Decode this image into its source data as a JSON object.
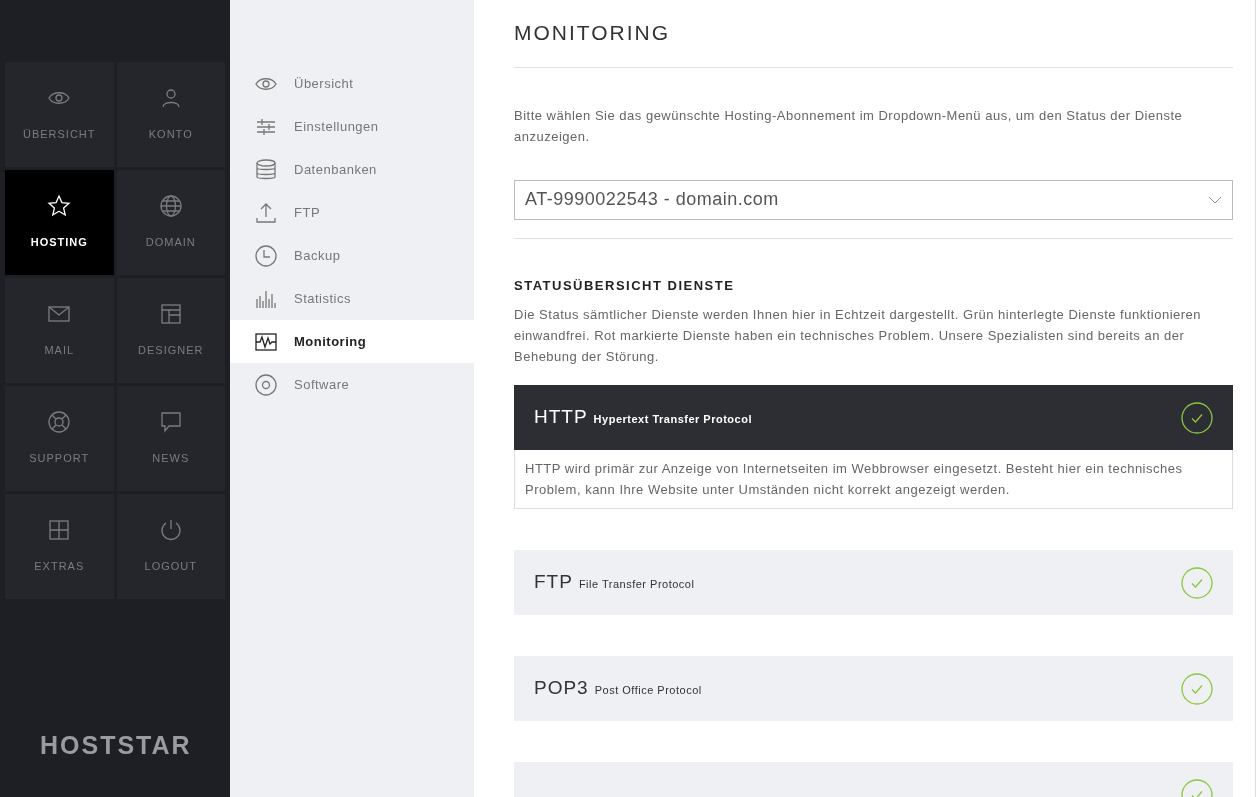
{
  "sidebar": {
    "tiles": [
      {
        "label": "ÜBERSICHT",
        "selected": false
      },
      {
        "label": "KONTO",
        "selected": false
      },
      {
        "label": "HOSTING",
        "selected": true
      },
      {
        "label": "DOMAIN",
        "selected": false
      },
      {
        "label": "MAIL",
        "selected": false
      },
      {
        "label": "DESIGNER",
        "selected": false
      },
      {
        "label": "SUPPORT",
        "selected": false
      },
      {
        "label": "NEWS",
        "selected": false
      },
      {
        "label": "EXTRAS",
        "selected": false
      },
      {
        "label": "LOGOUT",
        "selected": false
      }
    ],
    "logo": "HOSTSTAR"
  },
  "subnav": {
    "items": [
      {
        "label": "Übersicht",
        "selected": false
      },
      {
        "label": "Einstellungen",
        "selected": false
      },
      {
        "label": "Datenbanken",
        "selected": false
      },
      {
        "label": "FTP",
        "selected": false
      },
      {
        "label": "Backup",
        "selected": false
      },
      {
        "label": "Statistics",
        "selected": false
      },
      {
        "label": "Monitoring",
        "selected": true
      },
      {
        "label": "Software",
        "selected": false
      }
    ]
  },
  "main": {
    "title": "MONITORING",
    "intro": "Bitte wählen Sie das gewünschte Hosting-Abonnement im Dropdown-Menü aus, um den Status der Dienste anzuzeigen.",
    "subscription_select": {
      "value": "AT-9990022543 - domain.com"
    },
    "section_title": "STATUSÜBERSICHT DIENSTE",
    "section_text": "Die Status sämtlicher Dienste werden Ihnen hier in Echtzeit dargestellt. Grün hinterlegte Dienste funktionieren einwandfrei. Rot markierte Dienste haben ein technisches Problem. Unsere Spezialisten sind bereits an der Behebung der Störung.",
    "services": [
      {
        "name": "HTTP",
        "full_name": "Hypertext Transfer Protocol",
        "ok": true,
        "expanded": true,
        "description": "HTTP wird primär zur Anzeige von Internetseiten im Webbrowser eingesetzt. Besteht hier ein technisches Problem, kann Ihre Website unter Umständen nicht korrekt angezeigt werden."
      },
      {
        "name": "FTP",
        "full_name": "File Transfer Protocol",
        "ok": true,
        "expanded": false
      },
      {
        "name": "POP3",
        "full_name": "Post Office Protocol",
        "ok": true,
        "expanded": false
      },
      {
        "ok": true,
        "expanded": false
      }
    ]
  }
}
